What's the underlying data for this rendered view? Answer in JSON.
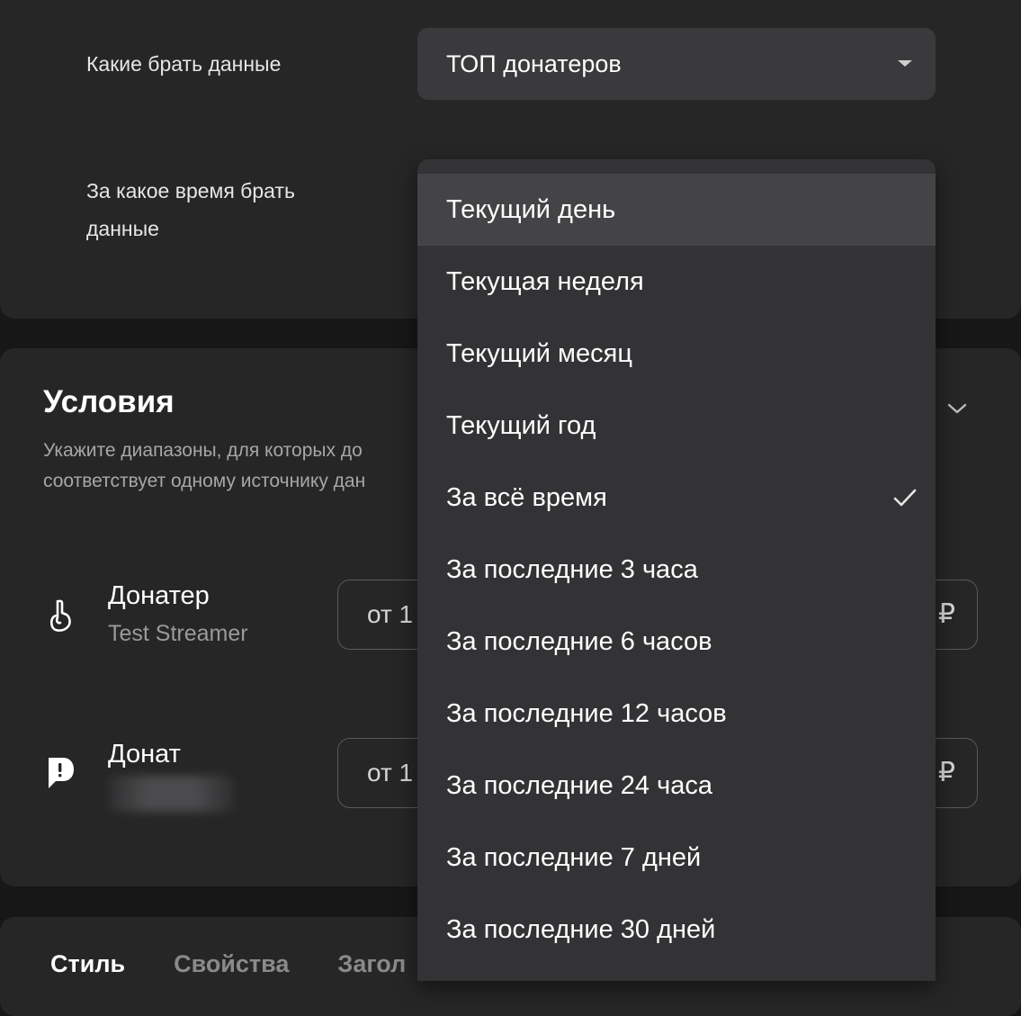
{
  "data_source": {
    "label": "Какие брать данные",
    "value": "ТОП донатеров"
  },
  "period": {
    "label_line1": "За какое время брать",
    "label_line2": "данные",
    "options": [
      "Текущий день",
      "Текущая неделя",
      "Текущий месяц",
      "Текущий год",
      "За всё время",
      "За последние 3 часа",
      "За последние 6 часов",
      "За последние 12 часов",
      "За последние 24 часа",
      "За последние 7 дней",
      "За последние 30 дней"
    ],
    "selected": "За всё время",
    "highlighted": "Текущий день"
  },
  "conditions": {
    "title": "Условия",
    "desc_line1": "Укажите диапазоны, для которых до",
    "desc_line2": "соответствует одному источнику дан",
    "rows": [
      {
        "title": "Донатер",
        "subtitle": "Test Streamer",
        "range_prefix": "от 1",
        "currency": "₽",
        "icon": "hand-gesture-icon"
      },
      {
        "title": "Донат",
        "subtitle": "",
        "range_prefix": "от 1",
        "currency": "₽",
        "icon": "donation-logo-icon"
      }
    ]
  },
  "tabs": [
    "Стиль",
    "Свойства",
    "Загол"
  ],
  "colors": {
    "background": "#171717",
    "card": "#262627",
    "menu": "#333335",
    "highlight": "#444446"
  }
}
